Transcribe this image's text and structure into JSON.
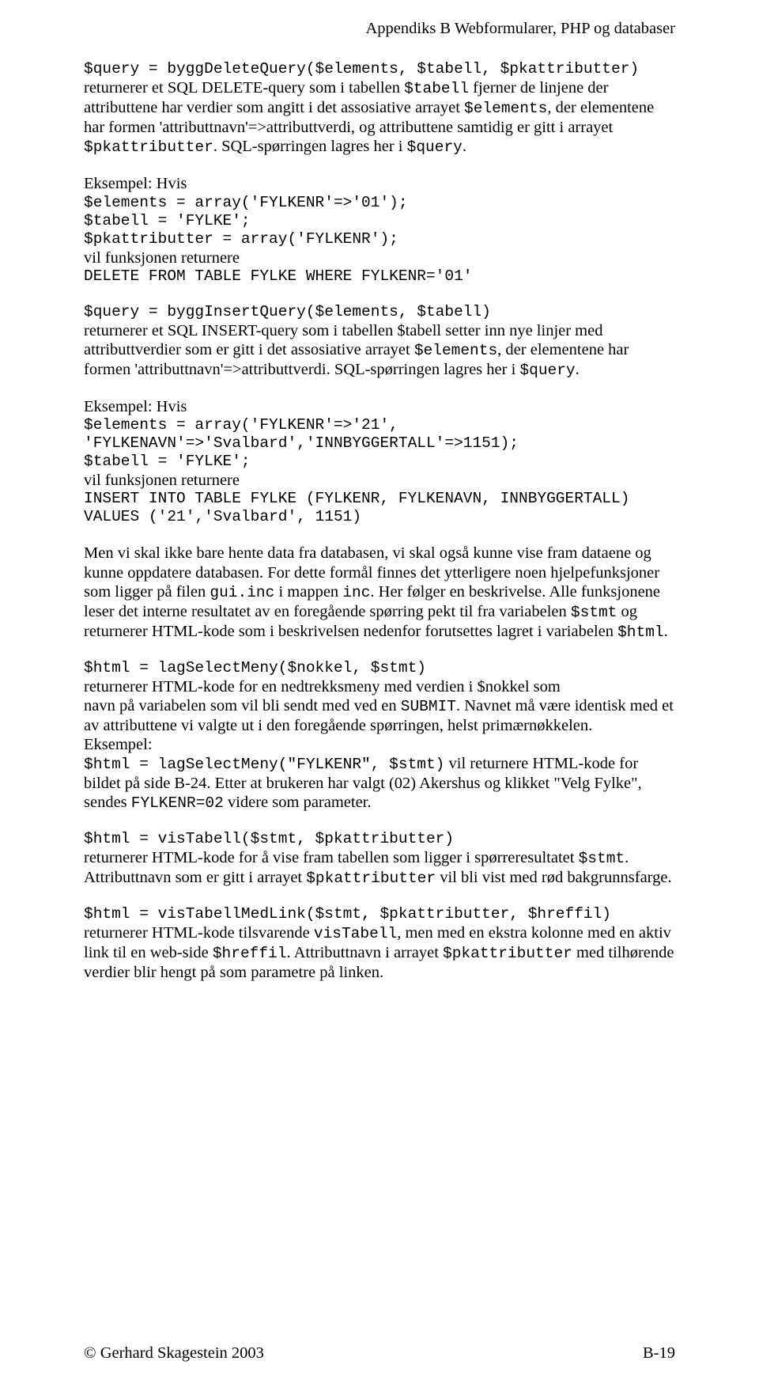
{
  "header": {
    "text": "Appendiks B Webformularer, PHP og databaser"
  },
  "p1": {
    "code1": "$query = byggDeleteQuery($elements, $tabell, $pkattributter)",
    "t1": "returnerer et SQL DELETE-query som i tabellen ",
    "c1": "$tabell",
    "t2": " fjerner de linjene der attributtene har verdier som angitt i det assosiative arrayet ",
    "c2": "$elements",
    "t3": ", der elementene har formen 'attributtnavn'=>attributtverdi, og attributtene samtidig er gitt i arrayet ",
    "c3": "$pkattributter",
    "t4": ". SQL-spørringen lagres her i ",
    "c4": "$query",
    "t5": "."
  },
  "p2": {
    "lead": "Eksempel: Hvis",
    "l1": "$elements = array('FYLKENR'=>'01');",
    "l2": "$tabell = 'FYLKE';",
    "l3": "$pkattributter = array('FYLKENR');",
    "mid": "vil funksjonen returnere",
    "l4": "DELETE FROM TABLE FYLKE WHERE FYLKENR='01'"
  },
  "p3": {
    "code1": "$query = byggInsertQuery($elements, $tabell)",
    "t1": "returnerer et SQL INSERT-query som i tabellen $tabell setter inn nye linjer med attributtverdier som er gitt i det assosiative arrayet ",
    "c1": "$elements",
    "t2": ", der elementene har formen 'attributtnavn'=>attributtverdi. SQL-spørringen lagres her i ",
    "c2": "$query",
    "t3": "."
  },
  "p4": {
    "lead": "Eksempel: Hvis",
    "l1": "$elements = array('FYLKENR'=>'21',",
    "l2": "'FYLKENAVN'=>'Svalbard','INNBYGGERTALL'=>1151);",
    "l3": "$tabell = 'FYLKE';",
    "mid": "vil funksjonen returnere",
    "l4": "INSERT INTO TABLE FYLKE (FYLKENR, FYLKENAVN, INNBYGGERTALL)",
    "l5": "VALUES ('21','Svalbard', 1151)"
  },
  "p5": {
    "t1": "Men vi skal ikke bare hente data fra databasen, vi skal også kunne vise fram dataene og kunne oppdatere databasen. For dette formål finnes det ytterligere noen hjelpefunksjoner som ligger på filen ",
    "c1": "gui.inc",
    "t2": " i mappen ",
    "c2": "inc",
    "t3": ". Her følger en beskrivelse. Alle funksjonene leser det interne resultatet av en foregående spørring pekt til fra variabelen ",
    "c3": "$stmt",
    "t4": "  og returnerer HTML-kode som i beskrivelsen nedenfor forutsettes lagret i variabelen ",
    "c4": "$html",
    "t5": "."
  },
  "p6": {
    "code1": "$html = lagSelectMeny($nokkel, $stmt)",
    "t1": "returnerer HTML-kode for en nedtrekksmeny med verdien i $nokkel som",
    "t2a": "navn på variabelen som vil bli sendt med ved en ",
    "c1": "SUBMIT",
    "t2b": ". Navnet må være identisk med et av attributtene vi valgte ut i den foregående spørringen, helst primærnøkkelen.",
    "t3": "Eksempel:",
    "code2": "$html = lagSelectMeny(\"FYLKENR\", $stmt)",
    "t4": "  vil returnere HTML-kode for bildet på side B-24. Etter at brukeren har valgt (02) Akershus og klikket \"Velg Fylke\", sendes ",
    "c2": "FYLKENR=02",
    "t5": " videre som parameter."
  },
  "p7": {
    "code1": "$html = visTabell($stmt, $pkattributter)",
    "t1": "returnerer HTML-kode for å vise fram tabellen som ligger i spørreresultatet ",
    "c1": "$stmt",
    "t2": ". Attributtnavn som er gitt i arrayet ",
    "c2": "$pkattributter",
    "t3": " vil bli vist med rød bakgrunnsfarge."
  },
  "p8": {
    "code1": "$html = visTabellMedLink($stmt, $pkattributter, $hreffil)",
    "t1": "returnerer HTML-kode tilsvarende ",
    "c1": "visTabell",
    "t2": ", men med en ekstra kolonne med en aktiv link til en web-side ",
    "c2": "$hreffil",
    "t3": ". Attributtnavn i arrayet ",
    "c3": "$pkattributter",
    "t4": " med tilhørende verdier blir hengt på som parametre på linken."
  },
  "footer": {
    "left": "© Gerhard Skagestein 2003",
    "right": "B-19"
  }
}
